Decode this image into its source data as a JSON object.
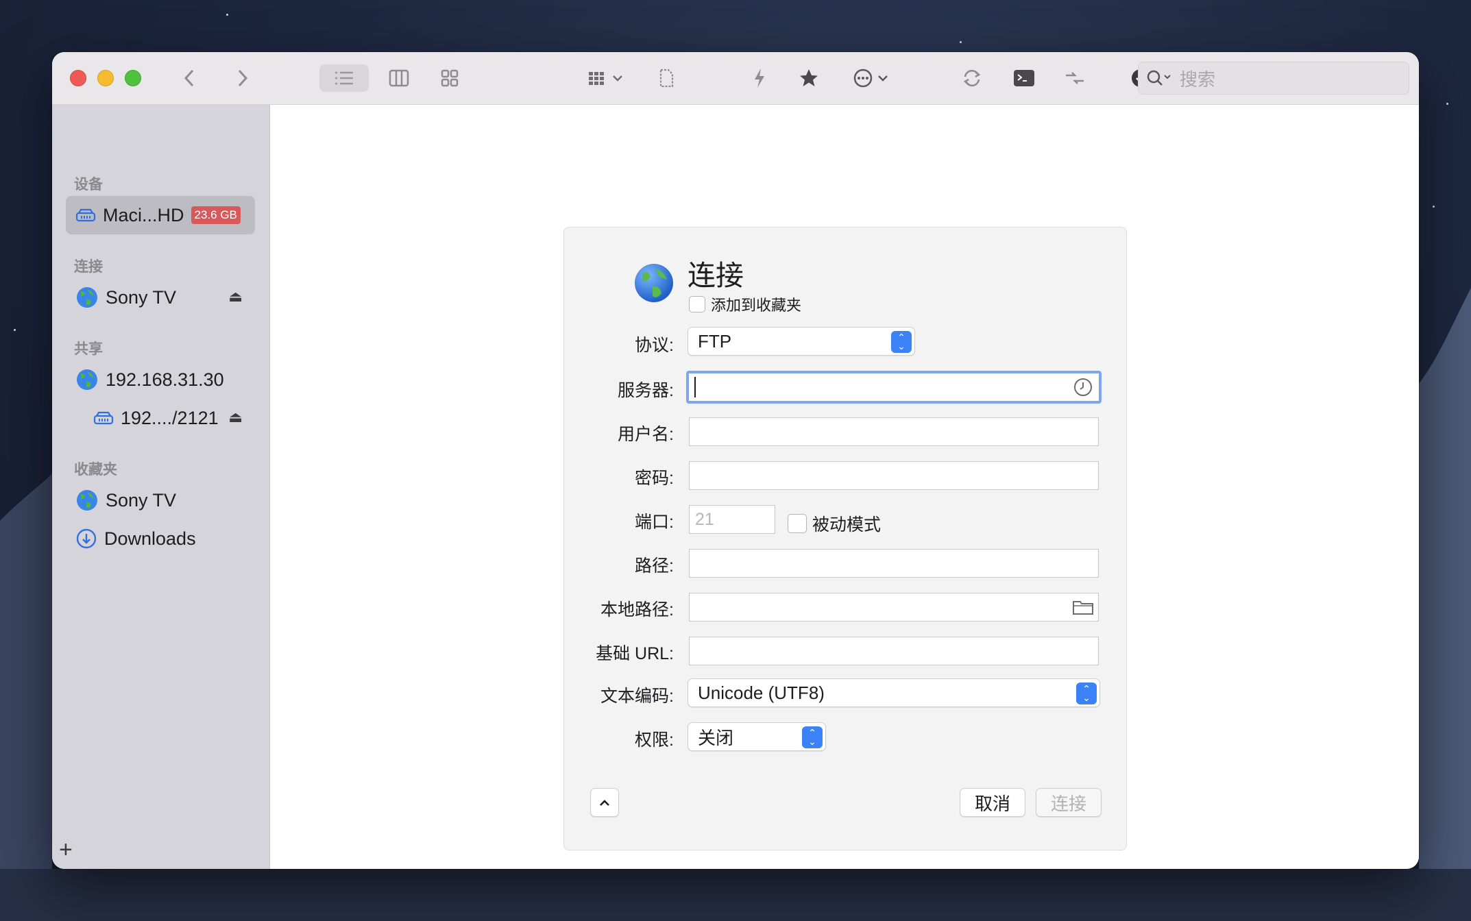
{
  "toolbar": {
    "search_placeholder": "搜索"
  },
  "sidebar": {
    "sections": {
      "devices": "设备",
      "connections": "连接",
      "shared": "共享",
      "favorites": "收藏夹"
    },
    "devices": [
      {
        "label": "Maci...HD",
        "badge": "23.6 GB",
        "icon": "drive-icon"
      }
    ],
    "connections": [
      {
        "label": "Sony TV",
        "icon": "globe-icon",
        "eject": "⏏"
      }
    ],
    "shared": [
      {
        "label": "192.168.31.30",
        "icon": "globe-icon"
      },
      {
        "label": "192..../2121",
        "icon": "drive-icon",
        "eject": "⏏"
      }
    ],
    "favorites": [
      {
        "label": "Sony TV",
        "icon": "globe-icon"
      },
      {
        "label": "Downloads",
        "icon": "download-icon"
      }
    ],
    "add_label": "+"
  },
  "dialog": {
    "title": "连接",
    "add_to_favorites": "添加到收藏夹",
    "labels": {
      "protocol": "协议:",
      "server": "服务器:",
      "username": "用户名:",
      "password": "密码:",
      "port": "端口:",
      "path": "路径:",
      "local_path": "本地路径:",
      "base_url": "基础 URL:",
      "encoding": "文本编码:",
      "permissions": "权限:"
    },
    "values": {
      "protocol": "FTP",
      "server": "",
      "username": "",
      "password": "",
      "port_placeholder": "21",
      "passive_mode": "被动模式",
      "path": "",
      "local_path": "",
      "base_url": "",
      "encoding": "Unicode (UTF8)",
      "permissions": "关闭"
    },
    "buttons": {
      "cancel": "取消",
      "connect": "连接"
    }
  },
  "colors": {
    "accent": "#3b82f7",
    "badge": "#d9595a",
    "focus_ring": "#7ea6ef"
  }
}
